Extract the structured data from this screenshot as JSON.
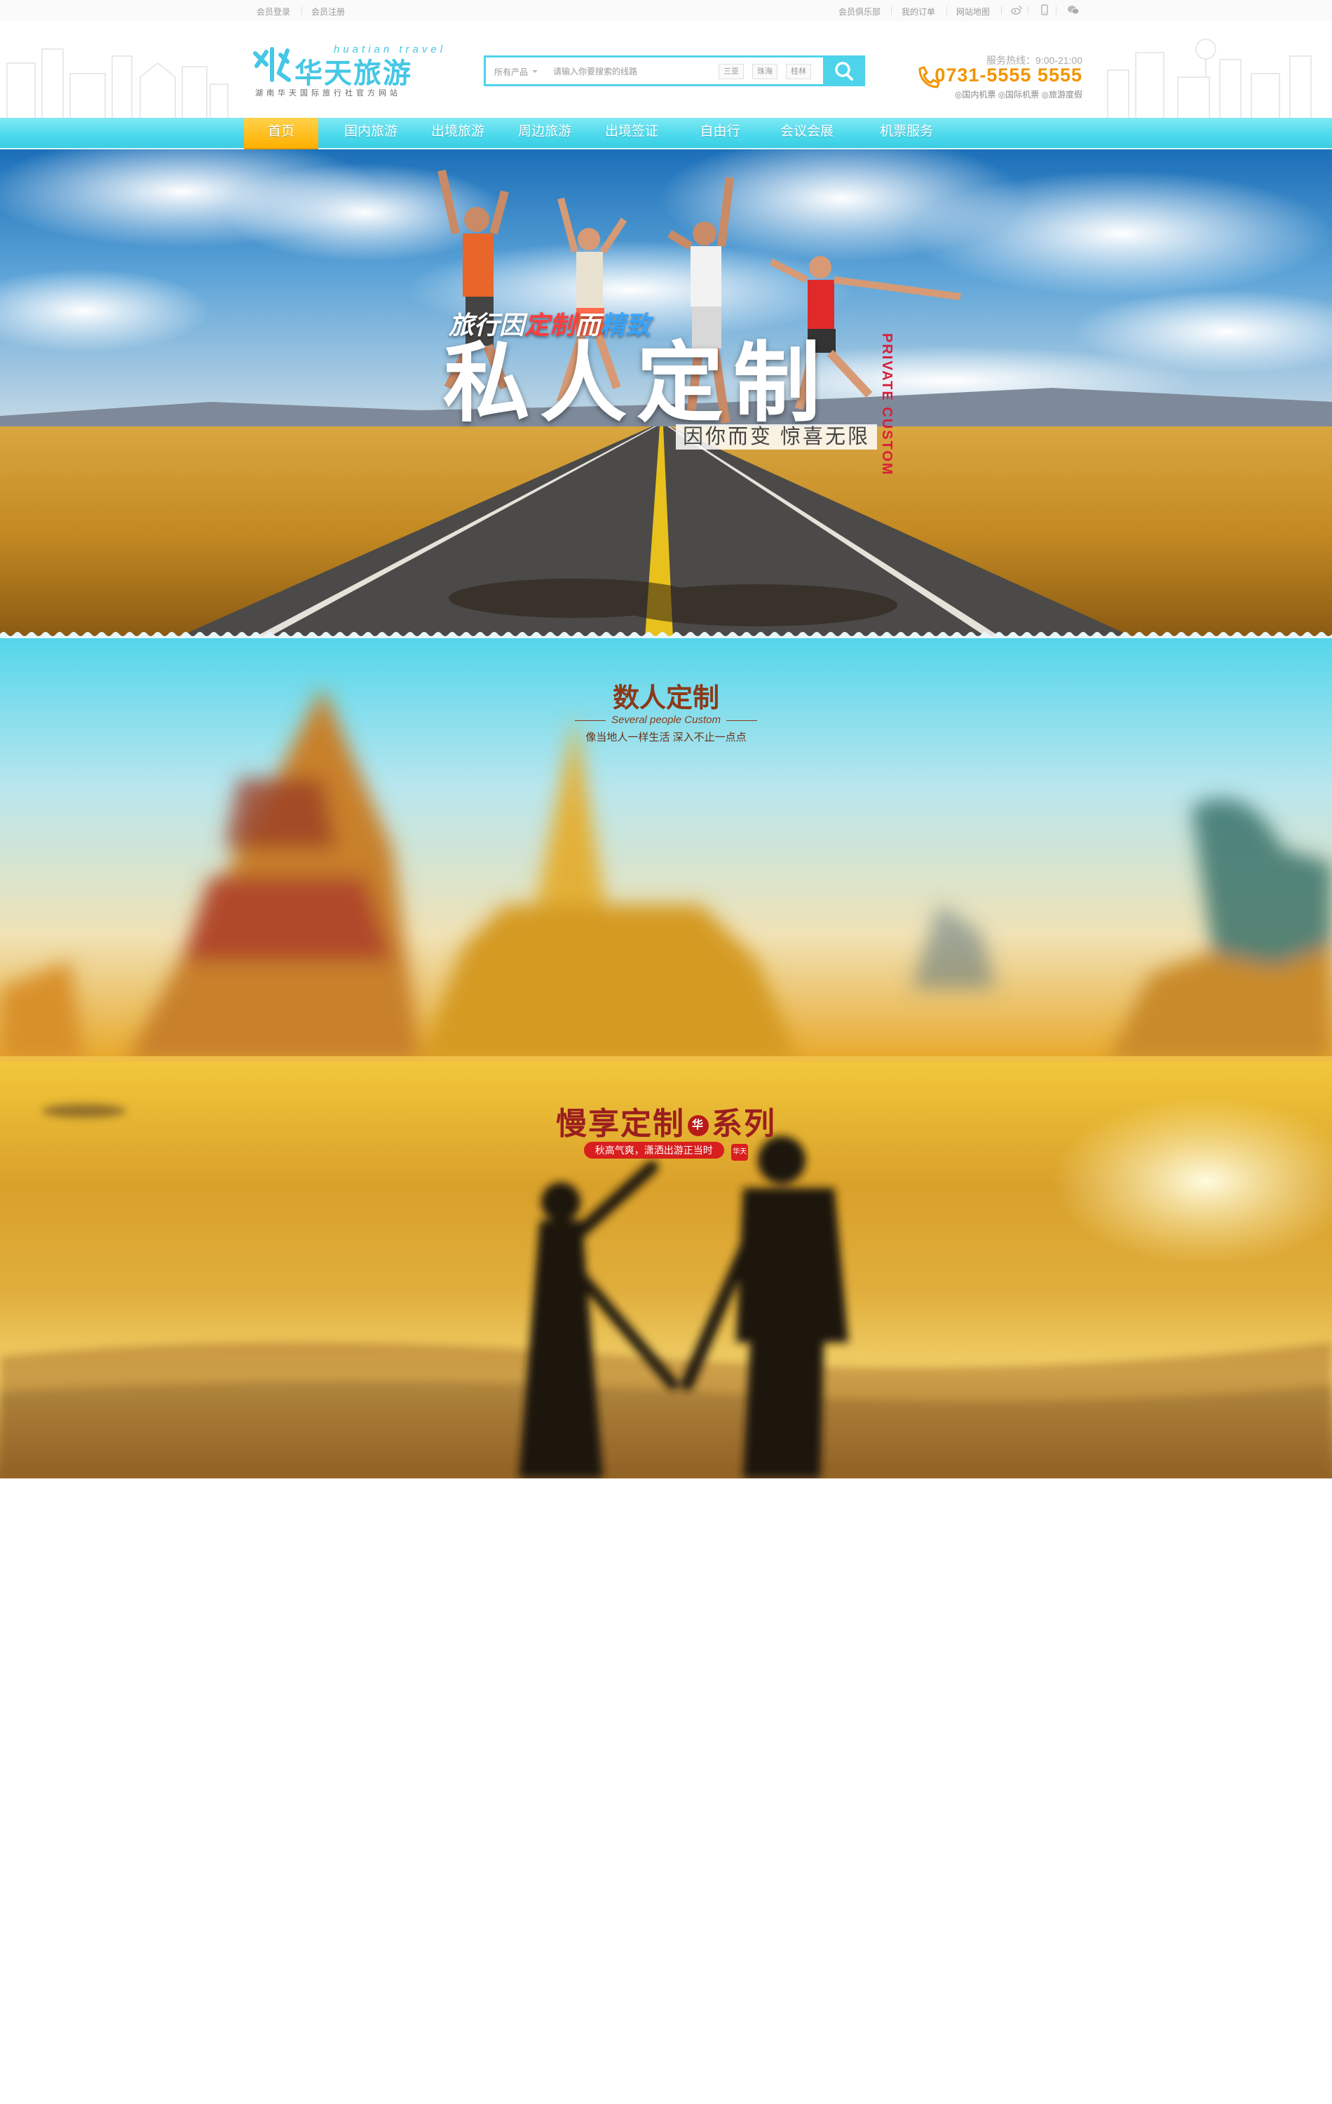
{
  "topbar": {
    "login": "会员登录",
    "register": "会员注册",
    "club": "会员俱乐部",
    "orders": "我的订单",
    "sitemap": "网站地图",
    "icons": [
      "weibo-icon",
      "mobile-icon",
      "wechat-icon"
    ]
  },
  "logo": {
    "cn": "华天旅游",
    "en": "huatian travel",
    "sub": "湖南华天国际旅行社官方网站"
  },
  "search": {
    "category": "所有产品",
    "placeholder": "请输入你要搜索的线路",
    "tags": [
      "三亚",
      "珠海",
      "桂林"
    ]
  },
  "hotline": {
    "label": "服务热线：9:00-21:00",
    "number": "0731-5555 5555",
    "links": "◎国内机票 ◎国际机票 ◎旅游度假"
  },
  "nav": {
    "items": [
      "首页",
      "国内旅游",
      "出境旅游",
      "周边旅游",
      "出境签证",
      "自由行",
      "会议会展",
      "机票服务"
    ],
    "active_index": 0
  },
  "banner1": {
    "slogan_a": "旅行因",
    "slogan_b": "定制",
    "slogan_c": "而",
    "slogan_d": "精致",
    "title": "私人定制",
    "vertical": "PRIVATE CUSTOM",
    "sub": "因你而变 惊喜无限"
  },
  "banner2": {
    "title": "数人定制",
    "en": "Several people Custom",
    "sub": "像当地人一样生活 深入不止一点点"
  },
  "banner3": {
    "title": "慢享定制",
    "badge": "华",
    "title2": "系列",
    "ribbon": "秋高气爽，潇洒出游正当时",
    "seal": "华天"
  },
  "colors": {
    "brand": "#45c7e6",
    "nav": "#4ad9ec",
    "active": "#ffb000",
    "hotline": "#f29400"
  }
}
